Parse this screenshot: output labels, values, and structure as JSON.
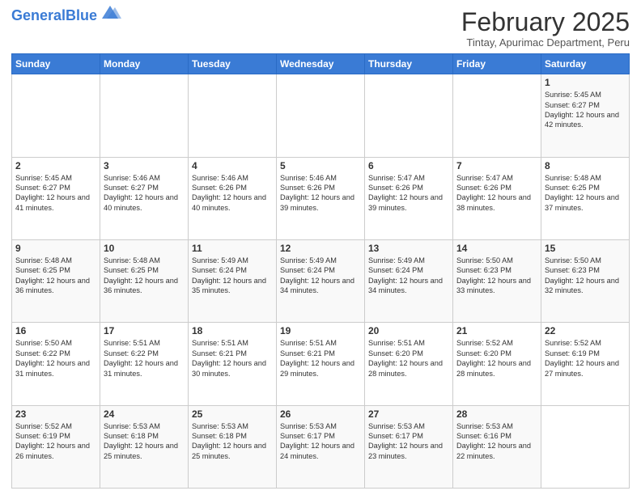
{
  "header": {
    "logo_general": "General",
    "logo_blue": "Blue",
    "month_year": "February 2025",
    "location": "Tintay, Apurimac Department, Peru"
  },
  "weekdays": [
    "Sunday",
    "Monday",
    "Tuesday",
    "Wednesday",
    "Thursday",
    "Friday",
    "Saturday"
  ],
  "weeks": [
    [
      {
        "day": "",
        "info": ""
      },
      {
        "day": "",
        "info": ""
      },
      {
        "day": "",
        "info": ""
      },
      {
        "day": "",
        "info": ""
      },
      {
        "day": "",
        "info": ""
      },
      {
        "day": "",
        "info": ""
      },
      {
        "day": "1",
        "info": "Sunrise: 5:45 AM\nSunset: 6:27 PM\nDaylight: 12 hours\nand 42 minutes."
      }
    ],
    [
      {
        "day": "2",
        "info": "Sunrise: 5:45 AM\nSunset: 6:27 PM\nDaylight: 12 hours\nand 41 minutes."
      },
      {
        "day": "3",
        "info": "Sunrise: 5:46 AM\nSunset: 6:27 PM\nDaylight: 12 hours\nand 40 minutes."
      },
      {
        "day": "4",
        "info": "Sunrise: 5:46 AM\nSunset: 6:26 PM\nDaylight: 12 hours\nand 40 minutes."
      },
      {
        "day": "5",
        "info": "Sunrise: 5:46 AM\nSunset: 6:26 PM\nDaylight: 12 hours\nand 39 minutes."
      },
      {
        "day": "6",
        "info": "Sunrise: 5:47 AM\nSunset: 6:26 PM\nDaylight: 12 hours\nand 39 minutes."
      },
      {
        "day": "7",
        "info": "Sunrise: 5:47 AM\nSunset: 6:26 PM\nDaylight: 12 hours\nand 38 minutes."
      },
      {
        "day": "8",
        "info": "Sunrise: 5:48 AM\nSunset: 6:25 PM\nDaylight: 12 hours\nand 37 minutes."
      }
    ],
    [
      {
        "day": "9",
        "info": "Sunrise: 5:48 AM\nSunset: 6:25 PM\nDaylight: 12 hours\nand 36 minutes."
      },
      {
        "day": "10",
        "info": "Sunrise: 5:48 AM\nSunset: 6:25 PM\nDaylight: 12 hours\nand 36 minutes."
      },
      {
        "day": "11",
        "info": "Sunrise: 5:49 AM\nSunset: 6:24 PM\nDaylight: 12 hours\nand 35 minutes."
      },
      {
        "day": "12",
        "info": "Sunrise: 5:49 AM\nSunset: 6:24 PM\nDaylight: 12 hours\nand 34 minutes."
      },
      {
        "day": "13",
        "info": "Sunrise: 5:49 AM\nSunset: 6:24 PM\nDaylight: 12 hours\nand 34 minutes."
      },
      {
        "day": "14",
        "info": "Sunrise: 5:50 AM\nSunset: 6:23 PM\nDaylight: 12 hours\nand 33 minutes."
      },
      {
        "day": "15",
        "info": "Sunrise: 5:50 AM\nSunset: 6:23 PM\nDaylight: 12 hours\nand 32 minutes."
      }
    ],
    [
      {
        "day": "16",
        "info": "Sunrise: 5:50 AM\nSunset: 6:22 PM\nDaylight: 12 hours\nand 31 minutes."
      },
      {
        "day": "17",
        "info": "Sunrise: 5:51 AM\nSunset: 6:22 PM\nDaylight: 12 hours\nand 31 minutes."
      },
      {
        "day": "18",
        "info": "Sunrise: 5:51 AM\nSunset: 6:21 PM\nDaylight: 12 hours\nand 30 minutes."
      },
      {
        "day": "19",
        "info": "Sunrise: 5:51 AM\nSunset: 6:21 PM\nDaylight: 12 hours\nand 29 minutes."
      },
      {
        "day": "20",
        "info": "Sunrise: 5:51 AM\nSunset: 6:20 PM\nDaylight: 12 hours\nand 28 minutes."
      },
      {
        "day": "21",
        "info": "Sunrise: 5:52 AM\nSunset: 6:20 PM\nDaylight: 12 hours\nand 28 minutes."
      },
      {
        "day": "22",
        "info": "Sunrise: 5:52 AM\nSunset: 6:19 PM\nDaylight: 12 hours\nand 27 minutes."
      }
    ],
    [
      {
        "day": "23",
        "info": "Sunrise: 5:52 AM\nSunset: 6:19 PM\nDaylight: 12 hours\nand 26 minutes."
      },
      {
        "day": "24",
        "info": "Sunrise: 5:53 AM\nSunset: 6:18 PM\nDaylight: 12 hours\nand 25 minutes."
      },
      {
        "day": "25",
        "info": "Sunrise: 5:53 AM\nSunset: 6:18 PM\nDaylight: 12 hours\nand 25 minutes."
      },
      {
        "day": "26",
        "info": "Sunrise: 5:53 AM\nSunset: 6:17 PM\nDaylight: 12 hours\nand 24 minutes."
      },
      {
        "day": "27",
        "info": "Sunrise: 5:53 AM\nSunset: 6:17 PM\nDaylight: 12 hours\nand 23 minutes."
      },
      {
        "day": "28",
        "info": "Sunrise: 5:53 AM\nSunset: 6:16 PM\nDaylight: 12 hours\nand 22 minutes."
      },
      {
        "day": "",
        "info": ""
      }
    ]
  ]
}
